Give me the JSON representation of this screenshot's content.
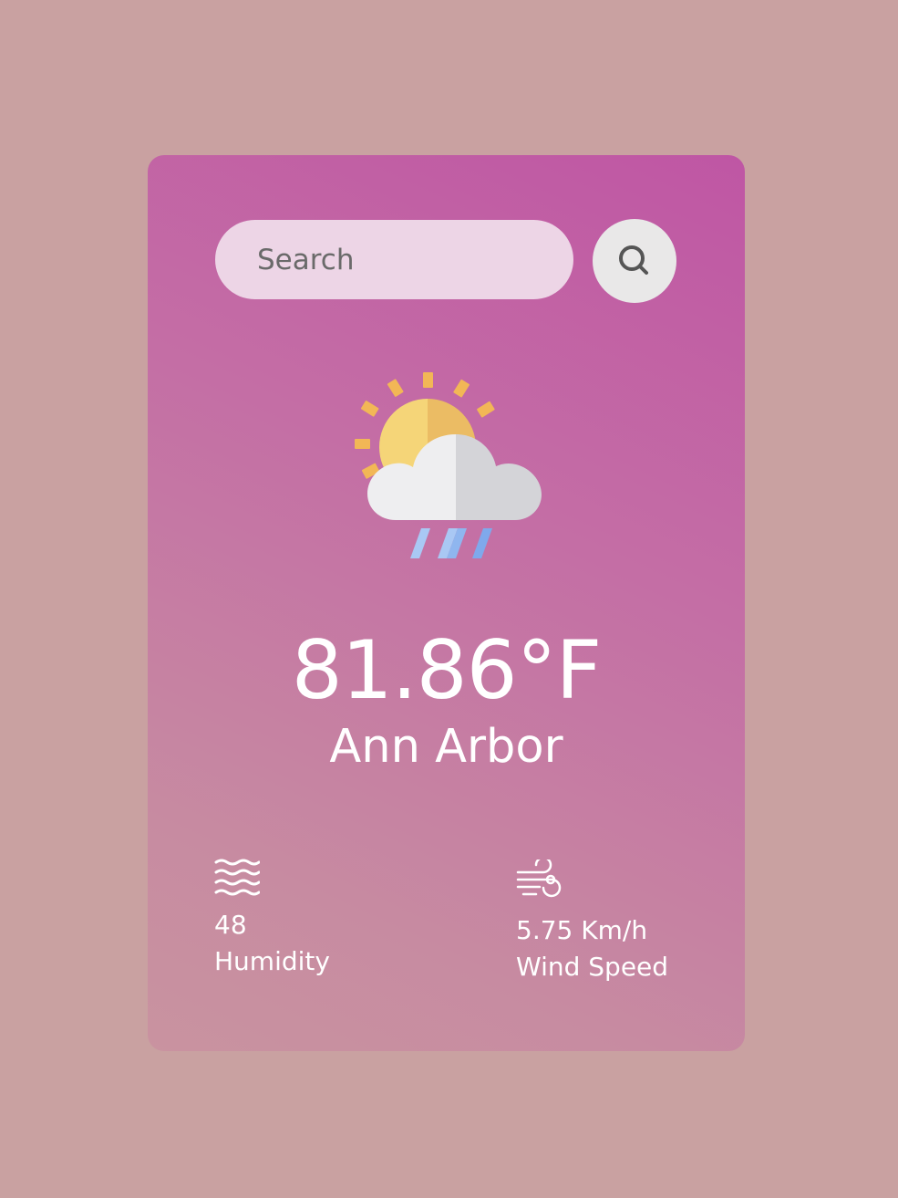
{
  "search": {
    "placeholder": "Search"
  },
  "icons": {
    "search_button": "search-icon",
    "weather": "partly-cloudy-rain-icon",
    "humidity": "humidity-waves-icon",
    "wind": "wind-icon"
  },
  "weather": {
    "temperature": "81.86°F",
    "city": "Ann Arbor"
  },
  "humidity": {
    "value": "48",
    "label": "Humidity"
  },
  "wind": {
    "value": "5.75 Km/h",
    "label": "Wind Speed"
  },
  "colors": {
    "background": "#c9a1a1",
    "card_top": "#bf56a4",
    "card_bottom": "#c993a0",
    "search_field": "#edd5e6",
    "search_button": "#e9e8e8"
  }
}
